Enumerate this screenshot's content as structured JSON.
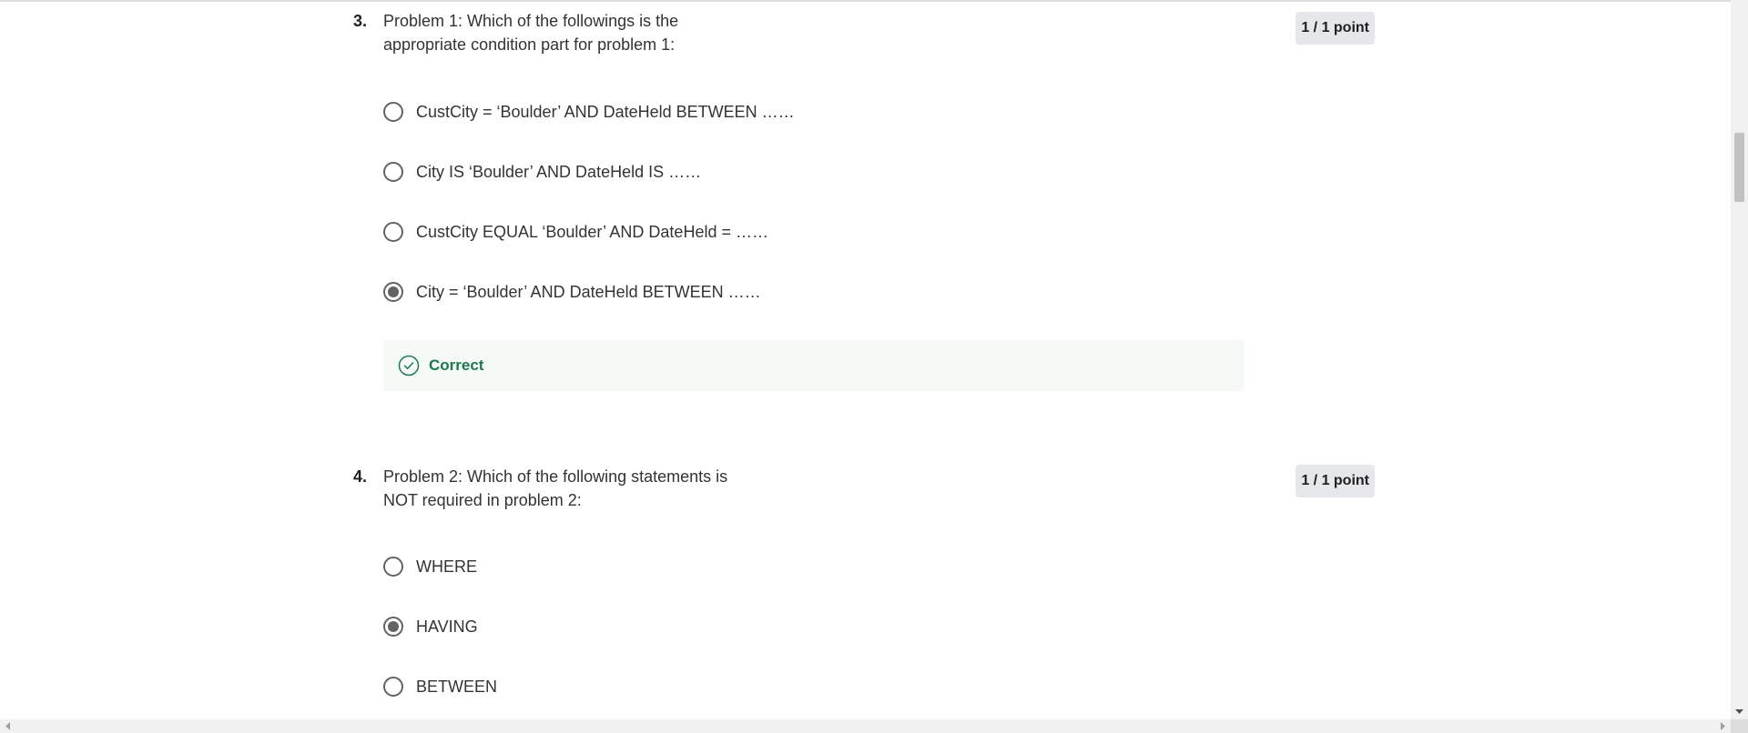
{
  "questions": [
    {
      "number": "3.",
      "text": "Problem 1: Which of the followings is the appropriate condition part for problem 1:",
      "points": "1 / 1 point",
      "options": [
        {
          "label": "CustCity = ‘Boulder’ AND DateHeld BETWEEN ……",
          "checked": false
        },
        {
          "label": "City IS ‘Boulder’ AND DateHeld IS ……",
          "checked": false
        },
        {
          "label": "CustCity EQUAL ‘Boulder’ AND DateHeld = ……",
          "checked": false
        },
        {
          "label": "City = ‘Boulder’ AND DateHeld BETWEEN ……",
          "checked": true
        }
      ],
      "feedback": {
        "label": "Correct",
        "icon": "check-circle-icon",
        "color": "#1d7a4b"
      }
    },
    {
      "number": "4.",
      "text": "Problem 2: Which of the following statements is NOT required in problem 2:",
      "points": "1 / 1 point",
      "options": [
        {
          "label": "WHERE",
          "checked": false
        },
        {
          "label": "HAVING",
          "checked": true
        },
        {
          "label": "BETWEEN",
          "checked": false
        }
      ]
    }
  ],
  "scrollbar": {
    "vertical_position_fraction": 0.2
  }
}
